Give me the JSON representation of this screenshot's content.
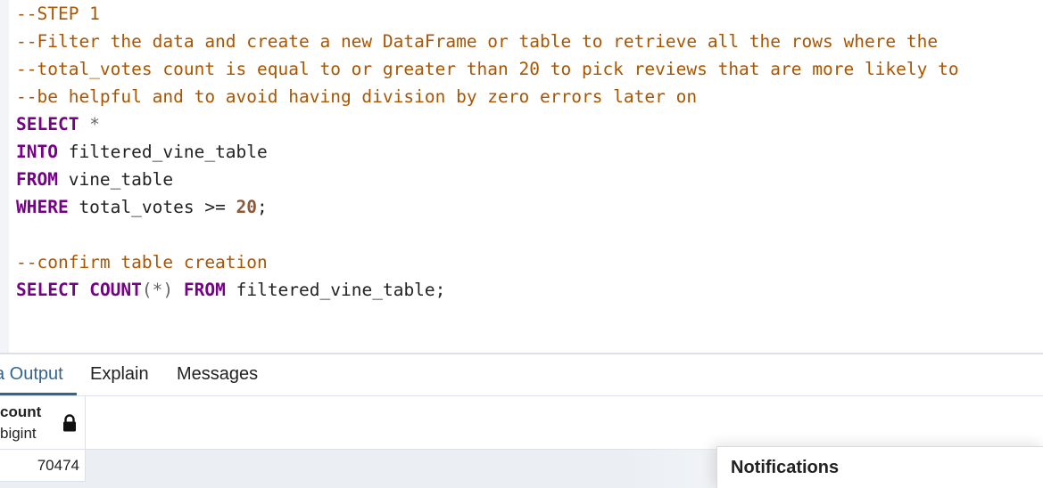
{
  "editor": {
    "lines": [
      [
        {
          "t": "comment",
          "v": "--STEP 1"
        }
      ],
      [
        {
          "t": "comment",
          "v": "--Filter the data and create a new DataFrame or table to retrieve all the rows where the"
        }
      ],
      [
        {
          "t": "comment",
          "v": "--total_votes count is equal to or greater than 20 to pick reviews that are more likely to"
        }
      ],
      [
        {
          "t": "comment",
          "v": "--be helpful and to avoid having division by zero errors later on"
        }
      ],
      [
        {
          "t": "kw",
          "v": "SELECT"
        },
        {
          "t": "plain",
          "v": " "
        },
        {
          "t": "op",
          "v": "*"
        }
      ],
      [
        {
          "t": "kw",
          "v": "INTO"
        },
        {
          "t": "plain",
          "v": " filtered_vine_table"
        }
      ],
      [
        {
          "t": "kw",
          "v": "FROM"
        },
        {
          "t": "plain",
          "v": " vine_table"
        }
      ],
      [
        {
          "t": "kw",
          "v": "WHERE"
        },
        {
          "t": "plain",
          "v": " total_votes >= "
        },
        {
          "t": "num",
          "v": "20"
        },
        {
          "t": "plain",
          "v": ";"
        }
      ],
      [
        {
          "t": "plain",
          "v": ""
        }
      ],
      [
        {
          "t": "comment",
          "v": "--confirm table creation"
        }
      ],
      [
        {
          "t": "kw",
          "v": "SELECT"
        },
        {
          "t": "plain",
          "v": " "
        },
        {
          "t": "kw",
          "v": "COUNT"
        },
        {
          "t": "op",
          "v": "(*)"
        },
        {
          "t": "plain",
          "v": " "
        },
        {
          "t": "kw",
          "v": "FROM"
        },
        {
          "t": "plain",
          "v": " filtered_vine_table;"
        }
      ]
    ]
  },
  "tabs": {
    "output": "a Output",
    "explain": "Explain",
    "messages": "Messages"
  },
  "grid": {
    "column_name": "count",
    "column_type": "bigint",
    "lock_icon": "lock-icon",
    "rows": [
      "70474"
    ]
  },
  "notifications": {
    "title": "Notifications"
  },
  "colors": {
    "comment": "#aa5500",
    "keyword": "#770088",
    "number": "#8a5a3c",
    "active_tab": "#326690"
  }
}
